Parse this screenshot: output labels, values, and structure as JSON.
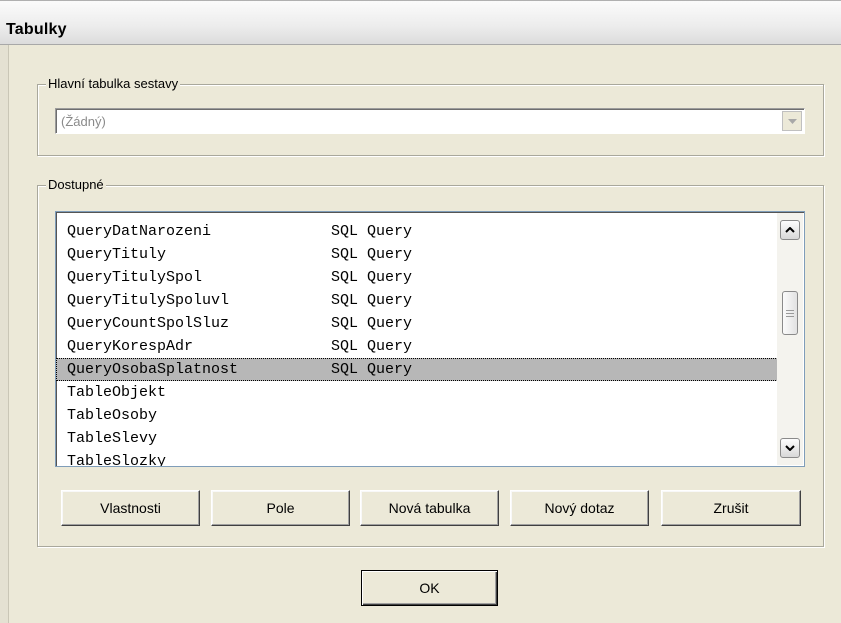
{
  "window": {
    "title": "Tabulky"
  },
  "main_table": {
    "legend": "Hlavní tabulka sestavy",
    "selected_value": "(Žádný)"
  },
  "available": {
    "legend": "Dostupné",
    "rows": [
      {
        "name": "QueryDatNarozeni",
        "type": "SQL Query"
      },
      {
        "name": "QueryTituly",
        "type": "SQL Query"
      },
      {
        "name": "QueryTitulySpol",
        "type": "SQL Query"
      },
      {
        "name": "QueryTitulySpoluvl",
        "type": "SQL Query"
      },
      {
        "name": "QueryCountSpolSluz",
        "type": "SQL Query"
      },
      {
        "name": "QueryKorespAdr",
        "type": "SQL Query"
      },
      {
        "name": "QueryOsobaSplatnost",
        "type": "SQL Query"
      },
      {
        "name": "TableObjekt",
        "type": ""
      },
      {
        "name": "TableOsoby",
        "type": ""
      },
      {
        "name": "TableSlevy",
        "type": ""
      },
      {
        "name": "TableSlozky",
        "type": ""
      }
    ],
    "selected_index": 6
  },
  "buttons": {
    "properties": "Vlastnosti",
    "fields": "Pole",
    "new_table": "Nová tabulka",
    "new_query": "Nový dotaz",
    "cancel": "Zrušit",
    "ok": "OK"
  },
  "icons": {
    "combo_dropdown": "chevron-down-icon",
    "scroll_up": "scroll-up-arrow-icon",
    "scroll_down": "scroll-down-arrow-icon",
    "scroll_grip": "grip-icon"
  },
  "colors": {
    "dialog_bg": "#ece9d8",
    "selection_bg": "#b7b7b7",
    "disabled_text": "#8a8a8a"
  }
}
